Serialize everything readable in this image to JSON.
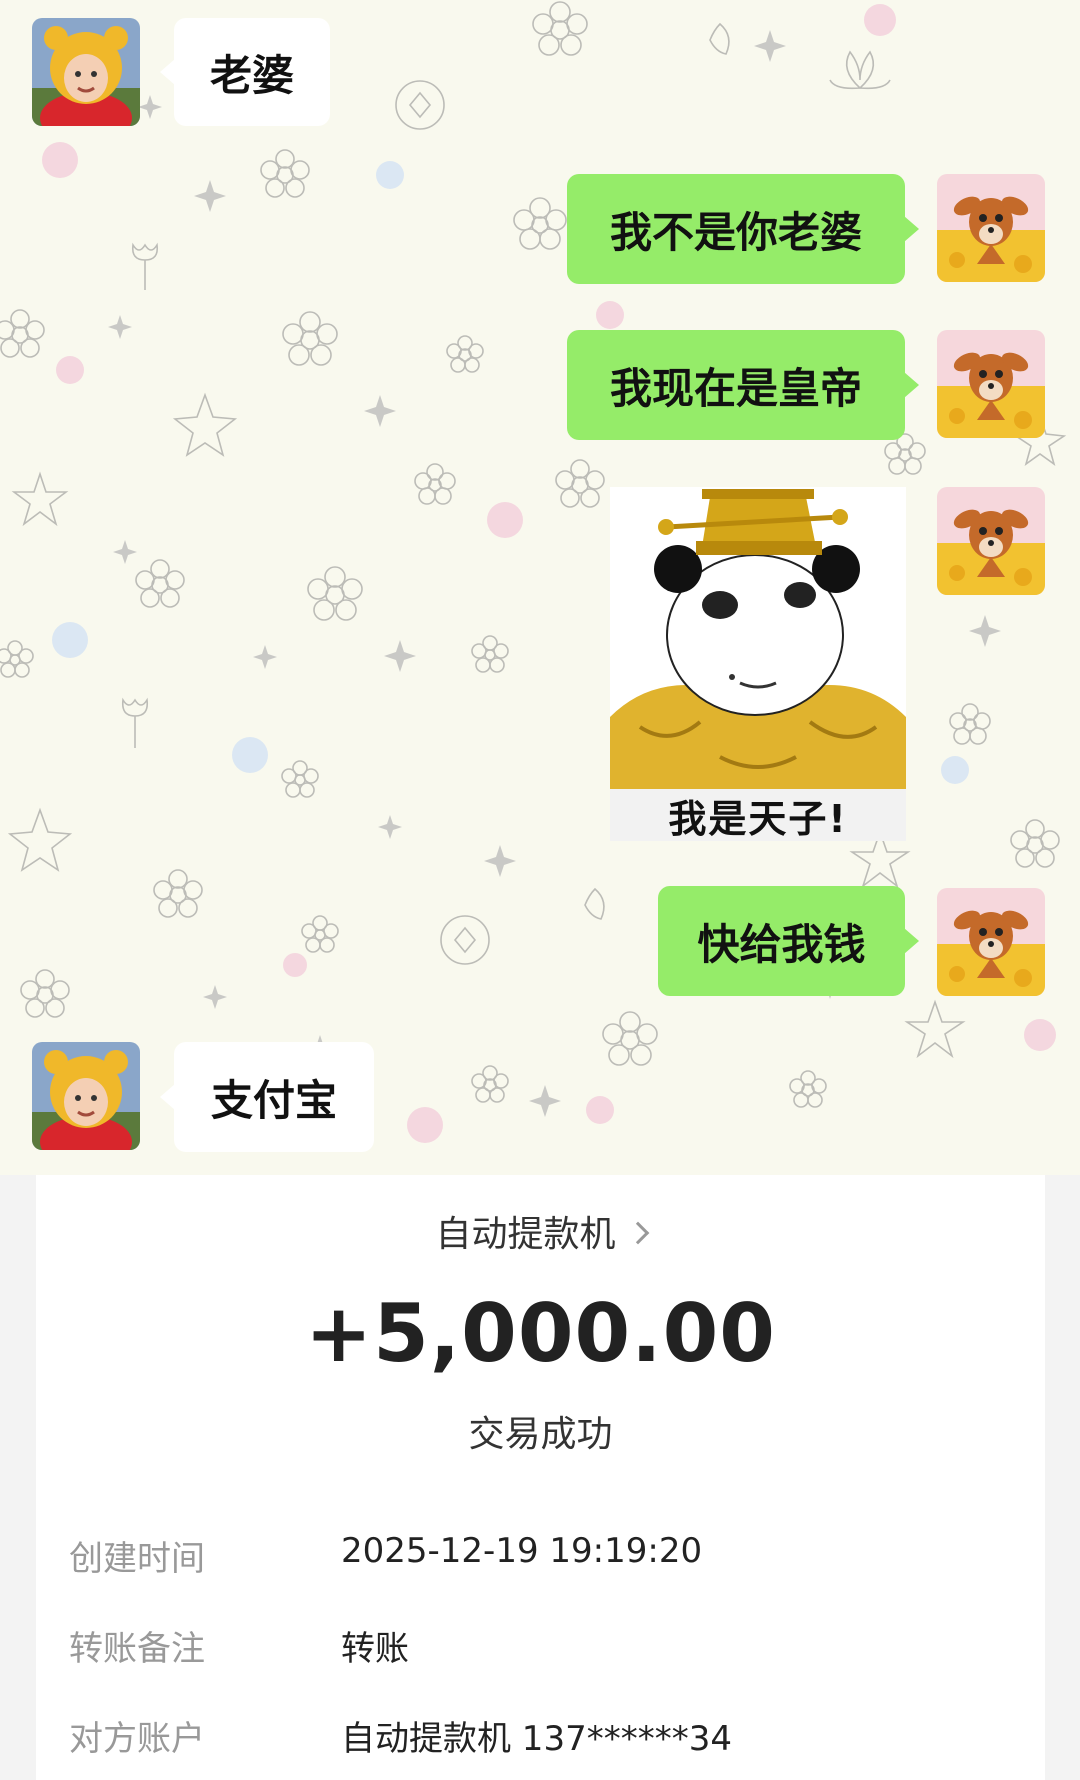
{
  "messages": [
    {
      "side": "left",
      "text": "老婆"
    },
    {
      "side": "right",
      "text": "我不是你老婆"
    },
    {
      "side": "right",
      "text": "我现在是皇帝"
    },
    {
      "side": "right",
      "sticker_caption": "我是天子!"
    },
    {
      "side": "right",
      "text": "快给我钱"
    },
    {
      "side": "left",
      "text": "支付宝"
    }
  ],
  "receipt": {
    "merchant": "自动提款机",
    "amount": "+5,000.00",
    "status": "交易成功",
    "fields": [
      {
        "label": "创建时间",
        "value": "2025-12-19 19:19:20"
      },
      {
        "label": "转账备注",
        "value": "转账"
      },
      {
        "label": "对方账户",
        "value": "自动提款机 137******34"
      }
    ]
  },
  "colors": {
    "self_bubble": "#95ec69",
    "other_bubble": "#ffffff",
    "chat_background": "#f9f9ee"
  },
  "icons": {
    "other_avatar": "winnie-pooh-costume-child",
    "self_avatar": "bambi-deer",
    "sticker": "panda-emperor",
    "merchant_chevron": "chevron-right-icon"
  }
}
